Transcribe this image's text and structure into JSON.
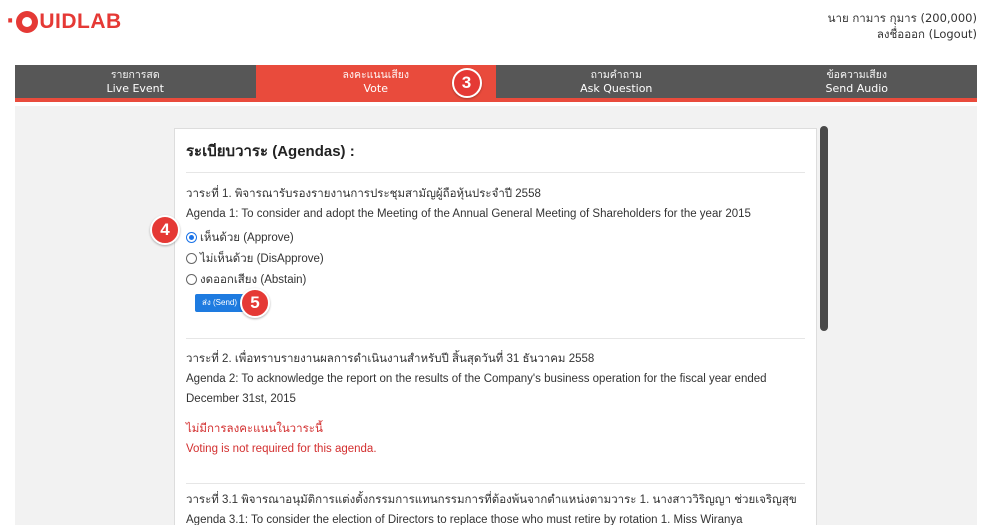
{
  "brand": {
    "dot": "·",
    "name": "UIDLAB"
  },
  "user": {
    "name": "นาย กามาร กุมาร (200,000)",
    "logout": "ลงชื่อออก (Logout)"
  },
  "nav": [
    {
      "th": "รายการสด",
      "en": "Live Event"
    },
    {
      "th": "ลงคะแนนเสียง",
      "en": "Vote"
    },
    {
      "th": "ถามคำถาม",
      "en": "Ask Question"
    },
    {
      "th": "ข้อความเสียง",
      "en": "Send Audio"
    }
  ],
  "active_tab": "Vote",
  "badges": {
    "nav": "3",
    "approve": "4",
    "send": "5"
  },
  "panel": {
    "title": "ระเบียบวาระ (Agendas) :",
    "agenda1": {
      "th": "วาระที่ 1. พิจารณารับรองรายงานการประชุมสามัญผู้ถือหุ้นประจำปี 2558",
      "en": "Agenda 1: To consider and adopt the Meeting of the Annual General Meeting of Shareholders for the year 2015",
      "options": [
        "เห็นด้วย (Approve)",
        "ไม่เห็นด้วย (DisApprove)",
        "งดออกเสียง (Abstain)"
      ],
      "selected": "เห็นด้วย (Approve)",
      "send": "ส่ง (Send)"
    },
    "agenda2": {
      "th": "วาระที่ 2. เพื่อทราบรายงานผลการดำเนินงานสำหรับปี สิ้นสุดวันที่ 31 ธันวาคม 2558",
      "en1": "Agenda 2: To acknowledge the report on the results of the Company's business operation for the fiscal year ended",
      "en2": "December 31st, 2015",
      "note_th": "ไม่มีการลงคะแนนในวาระนี้",
      "note_en": "Voting is not required for this agenda."
    },
    "agenda3": {
      "th": "วาระที่ 3.1 พิจารณาอนุมัติการแต่งตั้งกรรมการแทนกรรมการที่ต้องพ้นจากตำแหน่งตามวาระ 1. นางสาววิริญญา ช่วยเจริญสุข",
      "en": "Agenda 3.1: To consider the election of Directors to replace those who must retire by rotation 1. Miss Wiranya"
    }
  },
  "colors": {
    "brand_red": "#e53935",
    "nav_bg": "#575757",
    "active_tab": "#e94b3c",
    "send_button": "#1e7be0",
    "warning_text": "#d32f2f"
  }
}
